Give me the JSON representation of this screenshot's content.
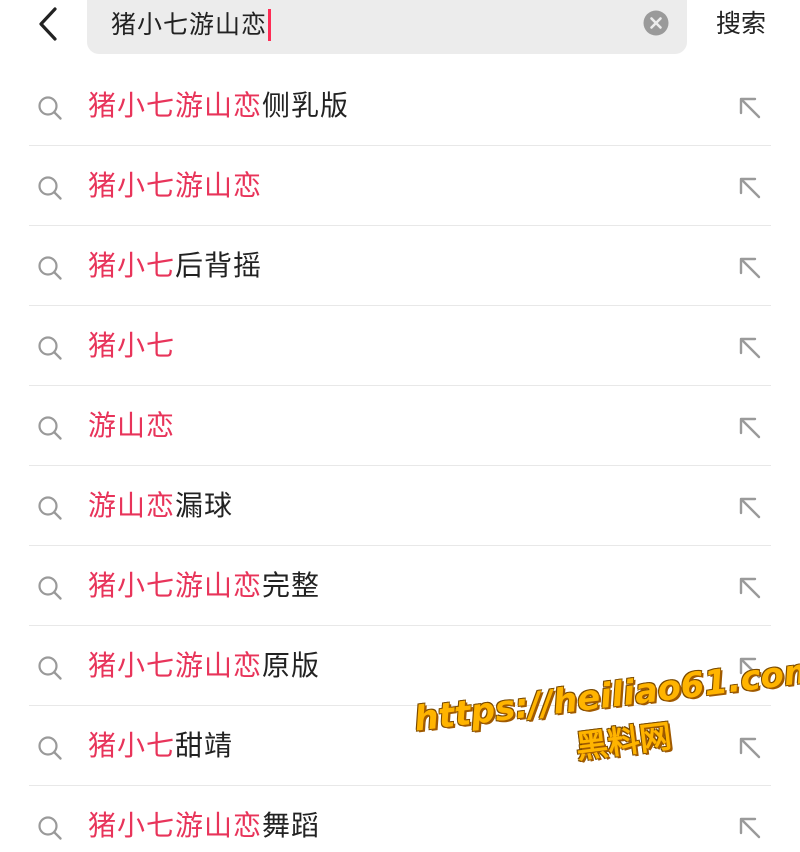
{
  "search": {
    "query": "猪小七游山恋",
    "submit_label": "搜索"
  },
  "colors": {
    "highlight": "#e8345a",
    "text": "#222222",
    "caret": "#fe2c55",
    "field_bg": "#ececec"
  },
  "icons": {
    "back": "chevron-left-icon",
    "clear": "clear-circle-icon",
    "row_leading": "search-icon",
    "row_trailing": "arrow-up-left-icon"
  },
  "suggestions": [
    {
      "highlight": "猪小七游山恋",
      "rest": "侧乳版"
    },
    {
      "highlight": "猪小七游山恋",
      "rest": ""
    },
    {
      "highlight": "猪小七",
      "rest": "后背摇"
    },
    {
      "highlight": "猪小七",
      "rest": ""
    },
    {
      "highlight": "游山恋",
      "rest": ""
    },
    {
      "highlight": "游山恋",
      "rest": "漏球"
    },
    {
      "highlight": "猪小七游山恋",
      "rest": "完整"
    },
    {
      "highlight": "猪小七游山恋",
      "rest": "原版"
    },
    {
      "highlight": "猪小七",
      "rest": "甜靖"
    },
    {
      "highlight": "猪小七游山恋",
      "rest": "舞蹈"
    }
  ],
  "watermark": {
    "line1": "https://heiliao61.com",
    "line2": "黑料网"
  }
}
